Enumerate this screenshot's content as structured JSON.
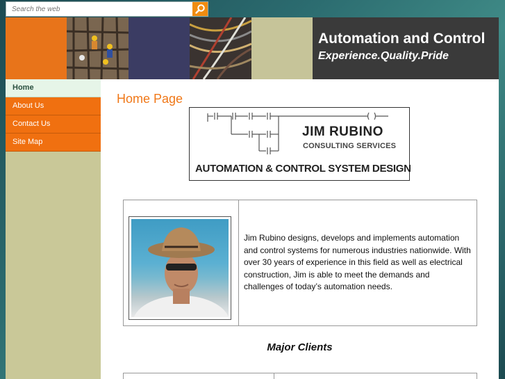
{
  "search": {
    "placeholder": "Search the web",
    "button_icon": "search-icon"
  },
  "banner": {
    "title": "Automation and Control",
    "slogan": "Experience.Quality.Pride",
    "colors": {
      "orange": "#e8741a",
      "navy": "#3b3c63",
      "khaki": "#c6c499",
      "dark": "#3a3a3a"
    }
  },
  "nav": {
    "items": [
      {
        "label": "Home",
        "active": true
      },
      {
        "label": "About Us",
        "active": false
      },
      {
        "label": "Contact Us",
        "active": false
      },
      {
        "label": "Site Map",
        "active": false
      }
    ]
  },
  "main": {
    "page_title": "Home Page",
    "logo": {
      "name": "JIM RUBINO",
      "subtitle": "CONSULTING SERVICES",
      "tagline": "AUTOMATION & CONTROL SYSTEM DESIGN"
    },
    "about_text": "Jim Rubino designs, develops and implements automation and control systems for numerous industries nationwide.  With over 30 years of experience in this field as well as electrical construction, Jim is able to meet the demands and challenges of today’s automation needs.",
    "clients_heading": "Major Clients"
  },
  "colors": {
    "accent": "#f07818",
    "nav_bg": "#f07010",
    "sidebar_bg": "#c9c898"
  }
}
